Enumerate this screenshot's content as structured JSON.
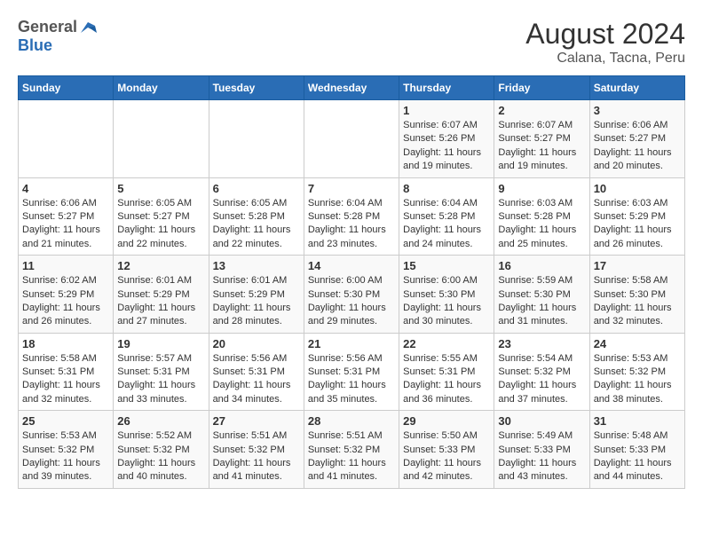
{
  "header": {
    "logo_general": "General",
    "logo_blue": "Blue",
    "title": "August 2024",
    "subtitle": "Calana, Tacna, Peru"
  },
  "weekdays": [
    "Sunday",
    "Monday",
    "Tuesday",
    "Wednesday",
    "Thursday",
    "Friday",
    "Saturday"
  ],
  "weeks": [
    [
      {
        "day": "",
        "info": ""
      },
      {
        "day": "",
        "info": ""
      },
      {
        "day": "",
        "info": ""
      },
      {
        "day": "",
        "info": ""
      },
      {
        "day": "1",
        "info": "Sunrise: 6:07 AM\nSunset: 5:26 PM\nDaylight: 11 hours and 19 minutes."
      },
      {
        "day": "2",
        "info": "Sunrise: 6:07 AM\nSunset: 5:27 PM\nDaylight: 11 hours and 19 minutes."
      },
      {
        "day": "3",
        "info": "Sunrise: 6:06 AM\nSunset: 5:27 PM\nDaylight: 11 hours and 20 minutes."
      }
    ],
    [
      {
        "day": "4",
        "info": "Sunrise: 6:06 AM\nSunset: 5:27 PM\nDaylight: 11 hours and 21 minutes."
      },
      {
        "day": "5",
        "info": "Sunrise: 6:05 AM\nSunset: 5:27 PM\nDaylight: 11 hours and 22 minutes."
      },
      {
        "day": "6",
        "info": "Sunrise: 6:05 AM\nSunset: 5:28 PM\nDaylight: 11 hours and 22 minutes."
      },
      {
        "day": "7",
        "info": "Sunrise: 6:04 AM\nSunset: 5:28 PM\nDaylight: 11 hours and 23 minutes."
      },
      {
        "day": "8",
        "info": "Sunrise: 6:04 AM\nSunset: 5:28 PM\nDaylight: 11 hours and 24 minutes."
      },
      {
        "day": "9",
        "info": "Sunrise: 6:03 AM\nSunset: 5:28 PM\nDaylight: 11 hours and 25 minutes."
      },
      {
        "day": "10",
        "info": "Sunrise: 6:03 AM\nSunset: 5:29 PM\nDaylight: 11 hours and 26 minutes."
      }
    ],
    [
      {
        "day": "11",
        "info": "Sunrise: 6:02 AM\nSunset: 5:29 PM\nDaylight: 11 hours and 26 minutes."
      },
      {
        "day": "12",
        "info": "Sunrise: 6:01 AM\nSunset: 5:29 PM\nDaylight: 11 hours and 27 minutes."
      },
      {
        "day": "13",
        "info": "Sunrise: 6:01 AM\nSunset: 5:29 PM\nDaylight: 11 hours and 28 minutes."
      },
      {
        "day": "14",
        "info": "Sunrise: 6:00 AM\nSunset: 5:30 PM\nDaylight: 11 hours and 29 minutes."
      },
      {
        "day": "15",
        "info": "Sunrise: 6:00 AM\nSunset: 5:30 PM\nDaylight: 11 hours and 30 minutes."
      },
      {
        "day": "16",
        "info": "Sunrise: 5:59 AM\nSunset: 5:30 PM\nDaylight: 11 hours and 31 minutes."
      },
      {
        "day": "17",
        "info": "Sunrise: 5:58 AM\nSunset: 5:30 PM\nDaylight: 11 hours and 32 minutes."
      }
    ],
    [
      {
        "day": "18",
        "info": "Sunrise: 5:58 AM\nSunset: 5:31 PM\nDaylight: 11 hours and 32 minutes."
      },
      {
        "day": "19",
        "info": "Sunrise: 5:57 AM\nSunset: 5:31 PM\nDaylight: 11 hours and 33 minutes."
      },
      {
        "day": "20",
        "info": "Sunrise: 5:56 AM\nSunset: 5:31 PM\nDaylight: 11 hours and 34 minutes."
      },
      {
        "day": "21",
        "info": "Sunrise: 5:56 AM\nSunset: 5:31 PM\nDaylight: 11 hours and 35 minutes."
      },
      {
        "day": "22",
        "info": "Sunrise: 5:55 AM\nSunset: 5:31 PM\nDaylight: 11 hours and 36 minutes."
      },
      {
        "day": "23",
        "info": "Sunrise: 5:54 AM\nSunset: 5:32 PM\nDaylight: 11 hours and 37 minutes."
      },
      {
        "day": "24",
        "info": "Sunrise: 5:53 AM\nSunset: 5:32 PM\nDaylight: 11 hours and 38 minutes."
      }
    ],
    [
      {
        "day": "25",
        "info": "Sunrise: 5:53 AM\nSunset: 5:32 PM\nDaylight: 11 hours and 39 minutes."
      },
      {
        "day": "26",
        "info": "Sunrise: 5:52 AM\nSunset: 5:32 PM\nDaylight: 11 hours and 40 minutes."
      },
      {
        "day": "27",
        "info": "Sunrise: 5:51 AM\nSunset: 5:32 PM\nDaylight: 11 hours and 41 minutes."
      },
      {
        "day": "28",
        "info": "Sunrise: 5:51 AM\nSunset: 5:32 PM\nDaylight: 11 hours and 41 minutes."
      },
      {
        "day": "29",
        "info": "Sunrise: 5:50 AM\nSunset: 5:33 PM\nDaylight: 11 hours and 42 minutes."
      },
      {
        "day": "30",
        "info": "Sunrise: 5:49 AM\nSunset: 5:33 PM\nDaylight: 11 hours and 43 minutes."
      },
      {
        "day": "31",
        "info": "Sunrise: 5:48 AM\nSunset: 5:33 PM\nDaylight: 11 hours and 44 minutes."
      }
    ]
  ]
}
